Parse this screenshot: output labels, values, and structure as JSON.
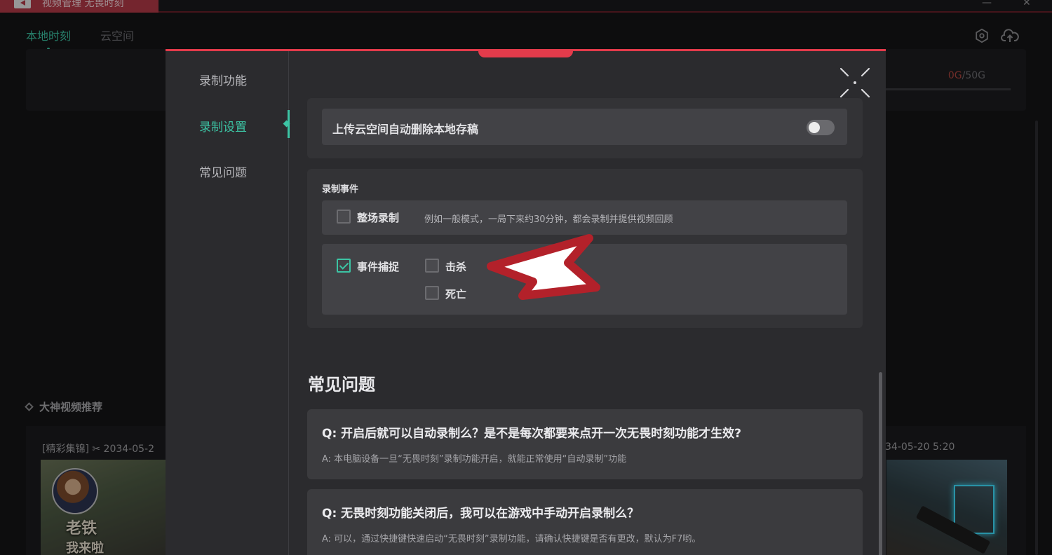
{
  "titlebar": {
    "title": "视频管理 无畏时刻",
    "minimize": "—",
    "close": "✕"
  },
  "app": {
    "tabs": [
      {
        "label": "本地时刻",
        "active": true
      },
      {
        "label": "云空间",
        "active": false
      }
    ],
    "icons": [
      "hexagon-settings-icon",
      "cloud-upload-icon"
    ],
    "storage": {
      "used": "0G",
      "separator": "/",
      "total": "50G"
    },
    "recommend_title": "大神视频推荐",
    "card_left_meta": "[精彩集锦] ✂ 2034-05-2",
    "card_right_meta": "34-05-20 5:20",
    "thumb_left_text1": "老铁",
    "thumb_left_text2": "我来啦"
  },
  "modal": {
    "accent": "#e33b4b",
    "nav": [
      {
        "label": "录制功能",
        "active": false
      },
      {
        "label": "录制设置",
        "active": true
      },
      {
        "label": "常见问题",
        "active": false
      }
    ],
    "upload_row": {
      "label": "上传云空间自动删除本地存稿",
      "toggle_on": false
    },
    "record_events": {
      "section_label": "录制事件",
      "full_match": {
        "label": "整场录制",
        "checked": false,
        "desc": "例如一般模式，一局下来约30分钟，都会录制并提供视频回顾"
      },
      "event_capture": {
        "label": "事件捕捉",
        "checked": true
      },
      "sub_events": [
        {
          "label": "击杀",
          "checked": false
        },
        {
          "label": "死亡",
          "checked": false
        }
      ]
    },
    "faq": {
      "title": "常见问题",
      "items": [
        {
          "q": "Q:  开启后就可以自动录制么？是不是每次都要来点开一次无畏时刻功能才生效?",
          "a": "A:  本电脑设备一旦“无畏时刻”录制功能开启，就能正常使用“自动录制”功能"
        },
        {
          "q": "Q:  无畏时刻功能关闭后，我可以在游戏中手动开启录制么？",
          "a": "A:  可以，通过快捷键快速启动“无畏时刻”录制功能，请确认快捷键是否有更改，默认为F7哟。"
        }
      ]
    }
  }
}
